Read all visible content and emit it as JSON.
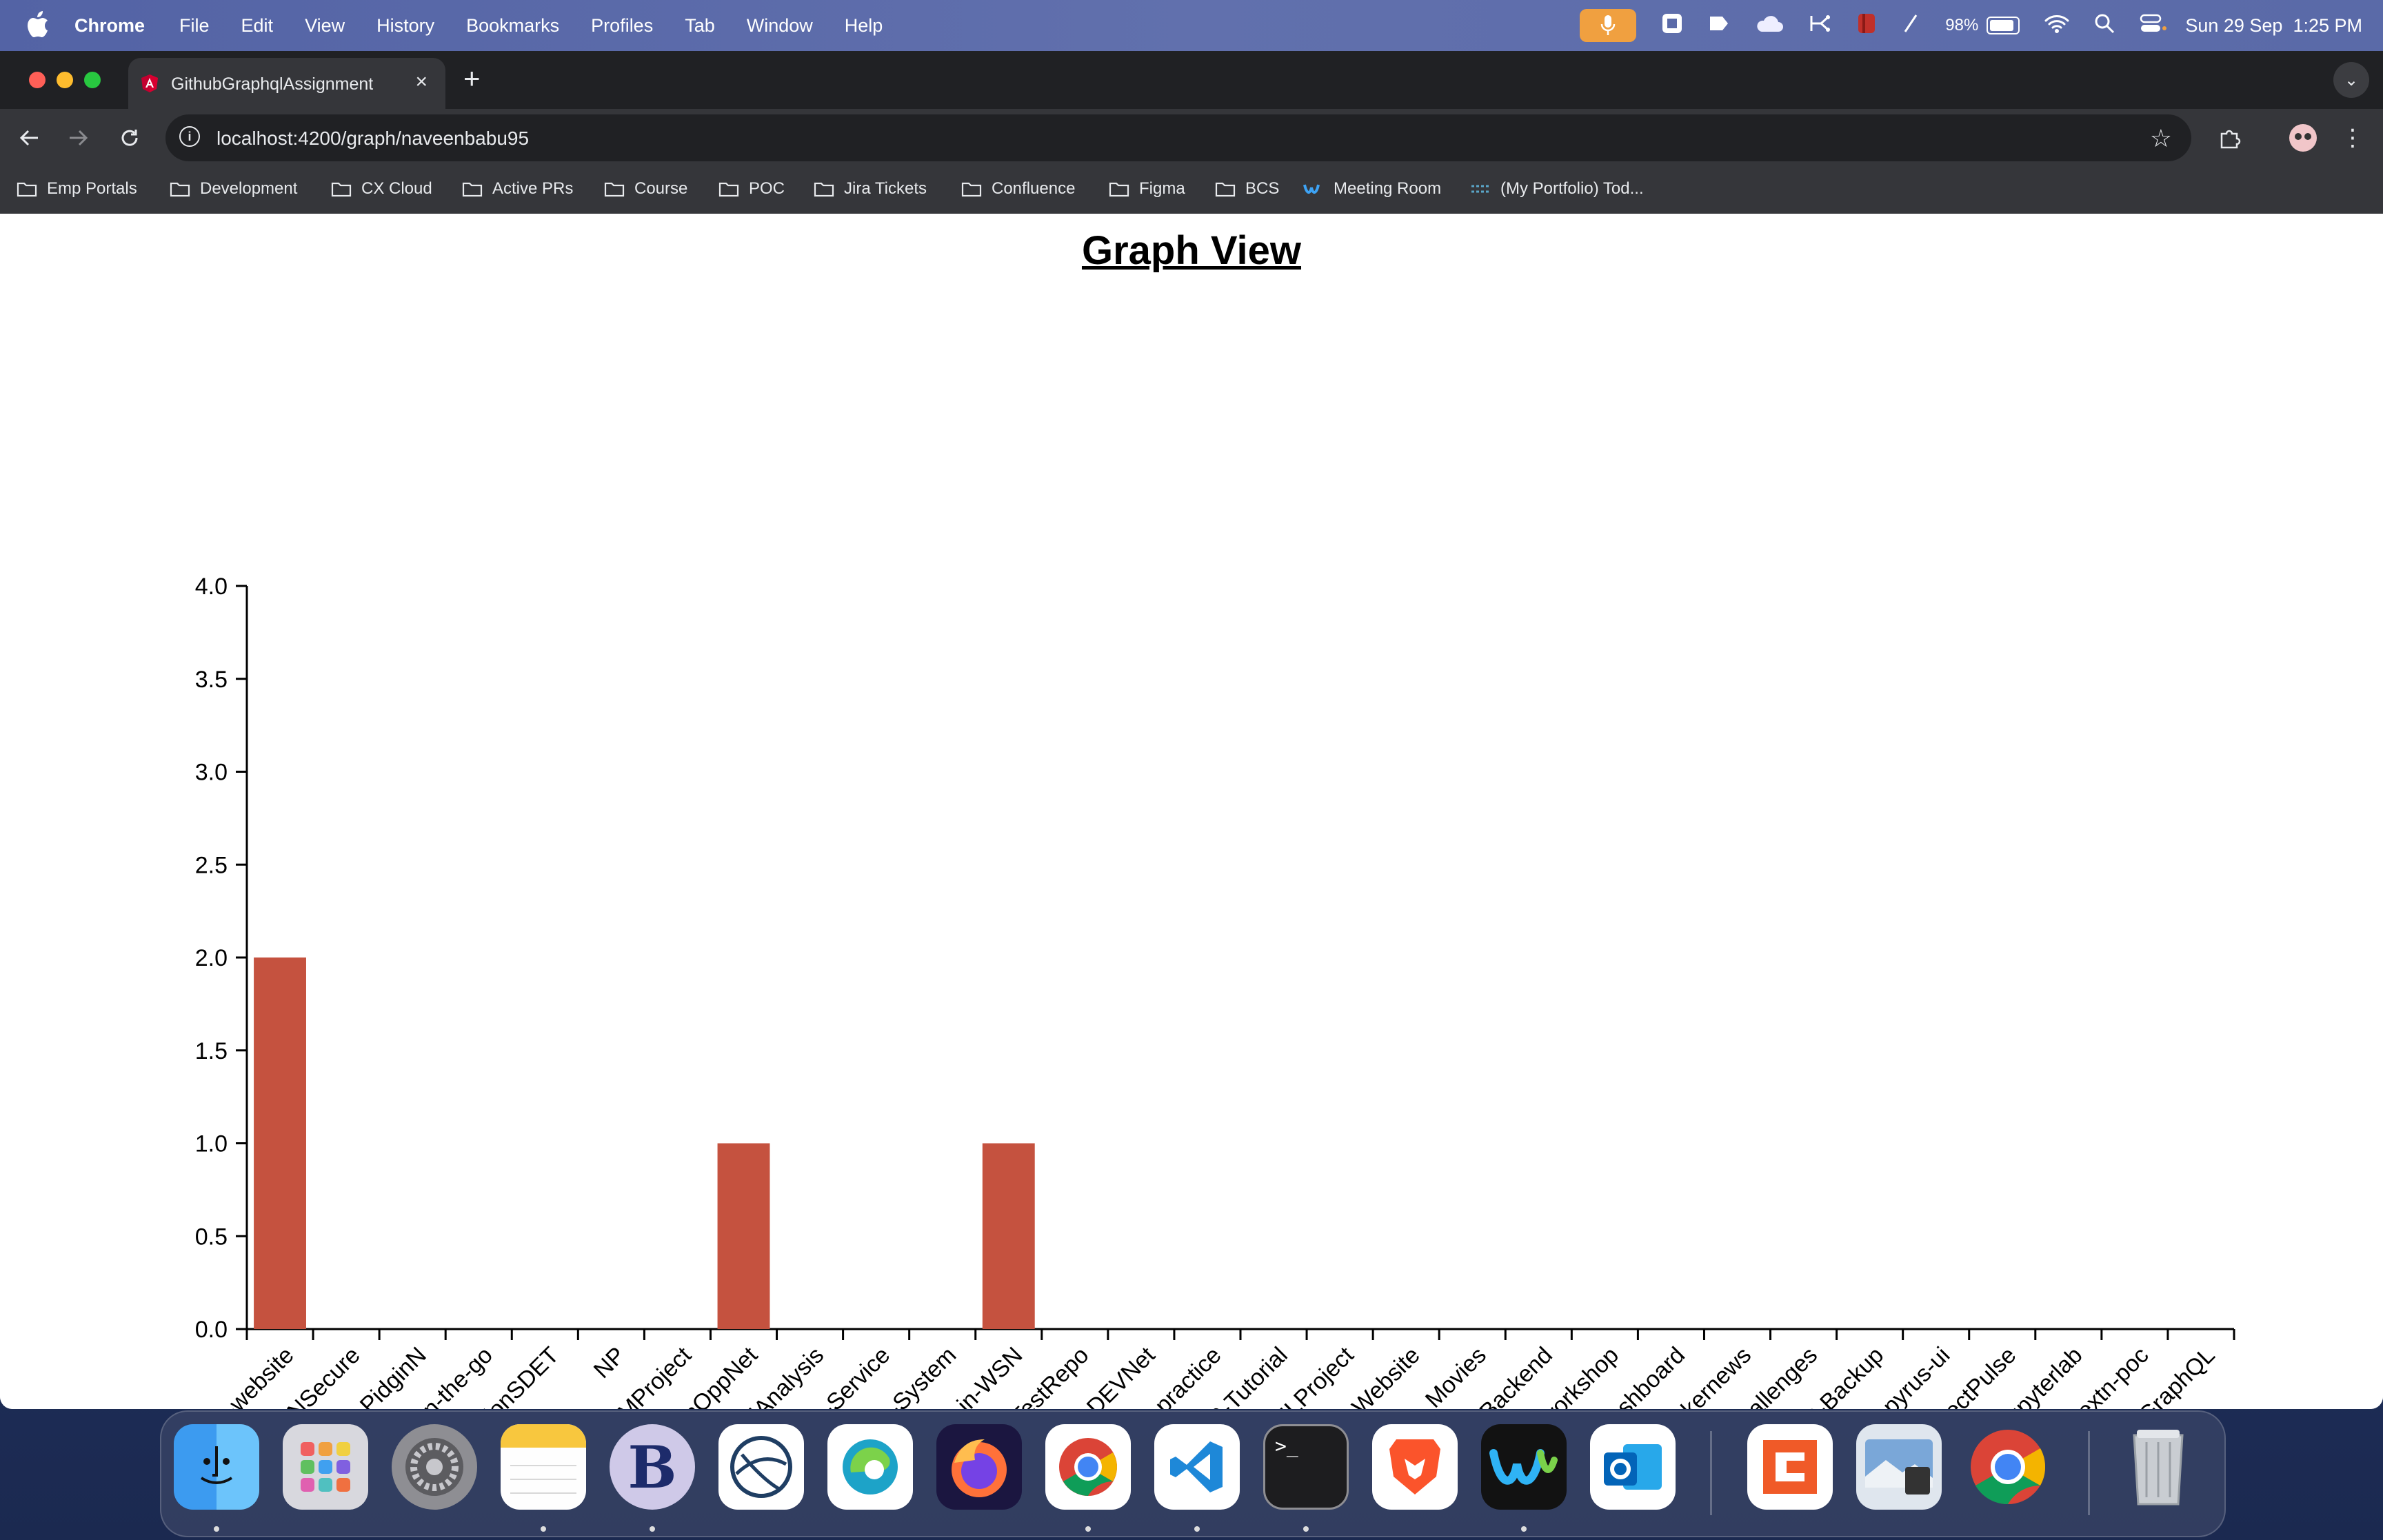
{
  "menubar": {
    "app_name": "Chrome",
    "menus": [
      "File",
      "Edit",
      "View",
      "History",
      "Bookmarks",
      "Profiles",
      "Tab",
      "Window",
      "Help"
    ],
    "battery": "98%",
    "datetime": "Sun 29 Sep  1:25 PM",
    "icons": [
      "mic-icon",
      "screen-capture-icon",
      "notes-flag-icon",
      "icloud-icon",
      "share-icon",
      "red-app-icon",
      "slash-icon",
      "battery-icon",
      "wifi-icon",
      "spotlight-icon",
      "control-center-icon"
    ]
  },
  "browser": {
    "tab_title": "GithubGraphqlAssignment",
    "url": "localhost:4200/graph/naveenbabu95",
    "bookmarks": [
      "Emp Portals",
      "Development",
      "CX Cloud",
      "Active PRs",
      "Course",
      "POC",
      "Jira Tickets",
      "Confluence",
      "Figma",
      "BCS",
      "Meeting Room",
      "(My Portfolio) Tod..."
    ]
  },
  "page": {
    "title": "Graph View"
  },
  "chart_data": {
    "type": "bar",
    "title": "",
    "xlabel": "",
    "ylabel": "",
    "ylim": [
      0,
      4
    ],
    "yticks": [
      "0.0",
      "0.5",
      "1.0",
      "1.5",
      "2.0",
      "2.5",
      "3.0",
      "3.5",
      "4.0"
    ],
    "bar_color": "#c5523f",
    "categories": [
      "BITS-website",
      "PANSecure",
      "PidginN",
      "dio-on-the-go",
      "llocationSDET",
      "NP",
      "STMProject",
      "dingInOppNet",
      "TrendAnalysis",
      "orage-Service",
      "ering-System",
      "uting-in-WSN",
      "TestRepo",
      "DEVNet",
      "ocker-practice",
      "CSS-Tutorial",
      "HTMLProject",
      "News-Website",
      "Star_Movies",
      "MovieBackend",
      "nx-workshop",
      "GITDashboard",
      "hackernews",
      "lar-challenges",
      "RP-Backup",
      "papyrus-ui",
      "ProjectPulse",
      "jupyterlab",
      "yter-extn-poc",
      "ub-GraphQL"
    ],
    "values": [
      2,
      0,
      0,
      0,
      0,
      0,
      0,
      1,
      0,
      0,
      0,
      1,
      0,
      0,
      0,
      0,
      0,
      0,
      0,
      0,
      0,
      0,
      0,
      0,
      0,
      0,
      0,
      0,
      0,
      0
    ]
  },
  "dock": {
    "apps": [
      "finder-icon",
      "launchpad-icon",
      "system-settings-icon",
      "notes-icon",
      "bbedit-icon",
      "eclipse-icon",
      "edge-icon",
      "firefox-icon",
      "chrome-icon",
      "vscode-icon",
      "terminal-icon",
      "brave-icon",
      "webex-icon",
      "outlook-icon",
      "postman-like-icon",
      "preview-icon",
      "chrome-secondary-icon",
      "trash-icon"
    ]
  }
}
